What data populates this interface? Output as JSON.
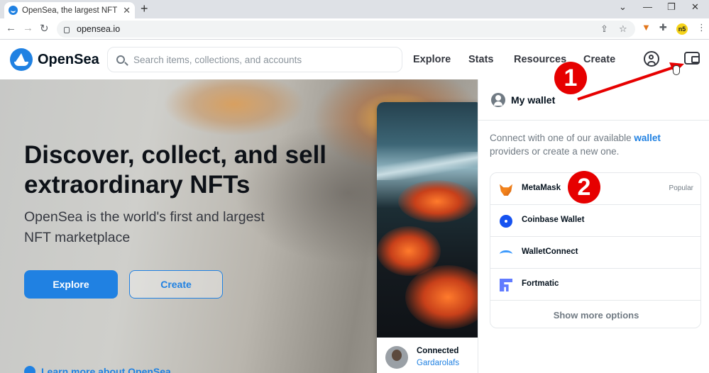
{
  "browser": {
    "tab_title": "OpenSea, the largest NFT marketplace",
    "url": "opensea.io",
    "new_tab_label": "+",
    "profile_badge": "n5"
  },
  "header": {
    "brand": "OpenSea",
    "search_placeholder": "Search items, collections, and accounts",
    "nav": [
      "Explore",
      "Stats",
      "Resources",
      "Create"
    ]
  },
  "hero": {
    "headline": "Discover, collect, and sell extraordinary NFTs",
    "subtitle": "OpenSea is the world's first and largest NFT marketplace",
    "primary_button": "Explore",
    "secondary_button": "Create",
    "learn_more": "Learn more about OpenSea"
  },
  "featured_card": {
    "status": "Connected",
    "creator": "Gardarolafs"
  },
  "wallet_panel": {
    "title": "My wallet",
    "description_prefix": "Connect with one of our available ",
    "description_link": "wallet",
    "description_suffix": " providers or create a new one.",
    "providers": [
      {
        "name": "MetaMask",
        "tag": "Popular",
        "icon": "metamask-icon"
      },
      {
        "name": "Coinbase Wallet",
        "tag": "",
        "icon": "coinbase-icon"
      },
      {
        "name": "WalletConnect",
        "tag": "",
        "icon": "walletconnect-icon"
      },
      {
        "name": "Fortmatic",
        "tag": "",
        "icon": "fortmatic-icon"
      }
    ],
    "show_more": "Show more options"
  },
  "annotations": {
    "step1": "1",
    "step2": "2",
    "color": "#e60000"
  },
  "colors": {
    "accent": "#2081e2",
    "text_dark": "#04111d",
    "text_muted": "#707a83"
  }
}
